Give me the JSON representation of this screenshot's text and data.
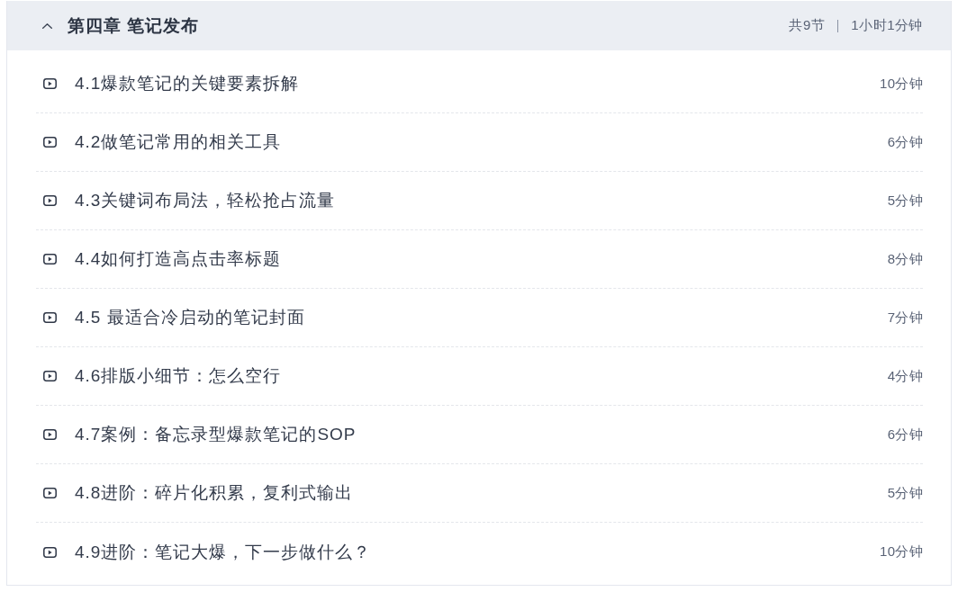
{
  "chapter": {
    "title": "第四章 笔记发布",
    "expanded": true,
    "lesson_count": "共9节",
    "total_duration": "1小时1分钟",
    "lessons": [
      {
        "title": "4.1爆款笔记的关键要素拆解",
        "duration": "10分钟"
      },
      {
        "title": "4.2做笔记常用的相关工具",
        "duration": "6分钟"
      },
      {
        "title": "4.3关键词布局法，轻松抢占流量",
        "duration": "5分钟"
      },
      {
        "title": "4.4如何打造高点击率标题",
        "duration": "8分钟"
      },
      {
        "title": "4.5 最适合冷启动的笔记封面",
        "duration": "7分钟"
      },
      {
        "title": "4.6排版小细节：怎么空行",
        "duration": "4分钟"
      },
      {
        "title": "4.7案例：备忘录型爆款笔记的SOP",
        "duration": "6分钟"
      },
      {
        "title": "4.8进阶：碎片化积累，复利式输出",
        "duration": "5分钟"
      },
      {
        "title": "4.9进阶：笔记大爆，下一步做什么？",
        "duration": "10分钟"
      }
    ]
  }
}
